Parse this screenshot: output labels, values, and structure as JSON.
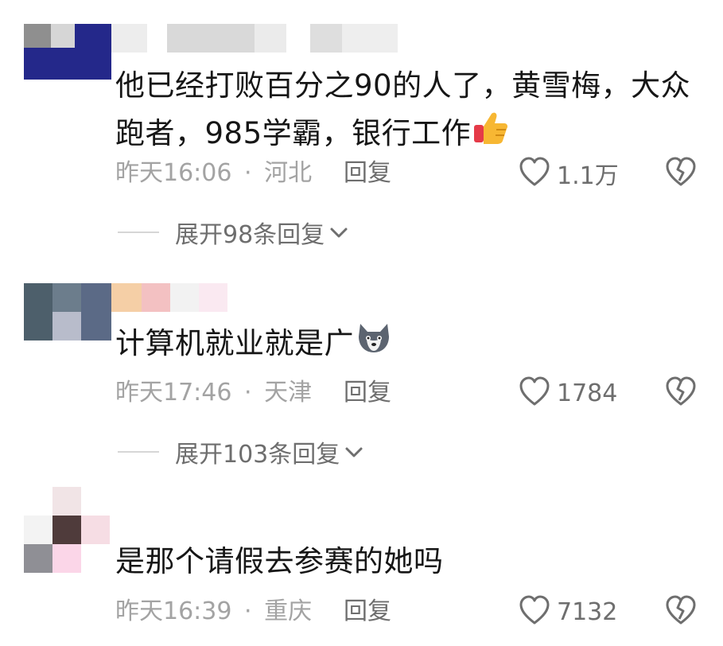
{
  "comments": [
    {
      "content": "他已经打败百分之90的人了，黄雪梅，大众跑者，985学霸，银行工作",
      "emoji": "thumbs-up-icon",
      "time": "昨天16:06",
      "location": "河北",
      "separator": "·",
      "reply_label": "回复",
      "likes": "1.1万",
      "expand_label": "展开98条回复"
    },
    {
      "content": "计算机就业就是广",
      "emoji": "husky-dog-icon",
      "time": "昨天17:46",
      "location": "天津",
      "separator": "·",
      "reply_label": "回复",
      "likes": "1784",
      "expand_label": "展开103条回复"
    },
    {
      "content": "是那个请假去参赛的她吗",
      "time": "昨天16:39",
      "location": "重庆",
      "separator": "·",
      "reply_label": "回复",
      "likes": "7132"
    }
  ],
  "colors": {
    "text_primary": "#161616",
    "text_meta": "#a3a3a3",
    "text_action": "#6e6e6e",
    "divider": "#d6d6d6"
  }
}
